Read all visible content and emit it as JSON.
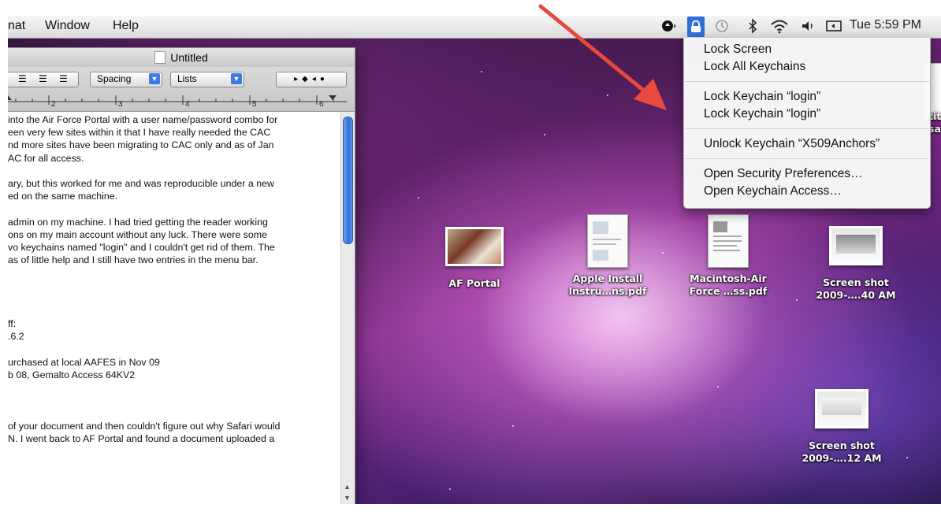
{
  "menubar": {
    "menus": [
      "nat",
      "Window",
      "Help"
    ],
    "clock": "Tue 5:59 PM"
  },
  "lock_menu": {
    "items": [
      "Lock Screen",
      "Lock All Keychains",
      "Lock Keychain “login”",
      "Lock Keychain “login”",
      "Unlock Keychain “X509Anchors”",
      "Open Security Preferences…",
      "Open Keychain Access…"
    ]
  },
  "textedit": {
    "title": "Untitled",
    "spacing_label": "Spacing",
    "lists_label": "Lists",
    "ruler_numbers": [
      "2",
      "3",
      "4",
      "5",
      "6"
    ],
    "lines": [
      " into the Air Force Portal with a user name/password combo for",
      "een very few sites within it that I have really needed the CAC",
      "nd more sites have been migrating to CAC only and as of Jan",
      "AC for all access.",
      "",
      "ary, but this worked for me and was reproducible under a new",
      "ed on the same machine.",
      "",
      " admin on my machine.  I had tried getting the reader working",
      "ons on my main account without any luck.  There were some",
      "vo keychains named \"login\" and I couldn't get rid of them.  The",
      "as of little help and I still have two entries in the menu bar.",
      "",
      "",
      "",
      "",
      "ff:",
      ".6.2",
      "",
      "urchased at local AAFES in Nov 09",
      "b 08, Gemalto Access 64KV2",
      "",
      "",
      "",
      " of your document and then couldn't figure out why Safari would",
      "N.  I went back to AF Portal and found a document uploaded a"
    ]
  },
  "desktop": {
    "icons": [
      {
        "label1": "AF Portal",
        "label2": ""
      },
      {
        "label1": "Apple Install",
        "label2": "Instru…ns.pdf"
      },
      {
        "label1": "Macintosh-Air",
        "label2": "Force …ss.pdf"
      },
      {
        "label1": "Screen shot",
        "label2": "2009-….40 AM"
      },
      {
        "label1": "Screen shot",
        "label2": "2009-….12 AM"
      }
    ],
    "edge_text": [
      "tit",
      "sa"
    ]
  },
  "colors": {
    "highlight": "#2f6fd8",
    "arrow": "#e8493d"
  }
}
